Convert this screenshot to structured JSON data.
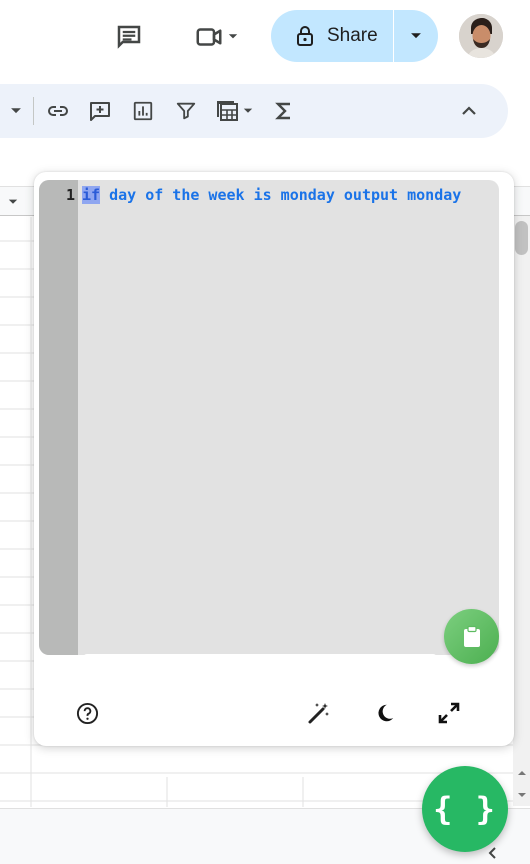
{
  "header": {
    "share_label": "Share",
    "comments_icon": "comment-icon",
    "meet_icon": "video-camera-icon",
    "avatar": "user-avatar"
  },
  "toolbar": {
    "items": [
      "link-icon",
      "insert-comment-icon",
      "insert-chart-icon",
      "filter-icon",
      "table-view-icon",
      "functions-icon"
    ],
    "collapse_icon": "chevron-up-icon"
  },
  "editor": {
    "line_number": "1",
    "code_keyword": "if",
    "code_rest": " day of the week is monday output monday",
    "copy_icon": "clipboard-icon"
  },
  "panel_footer": {
    "help_icon": "help-circle-icon",
    "magic_icon": "auto-fix-icon",
    "dark_mode_icon": "moon-icon",
    "expand_icon": "expand-icon"
  },
  "fab": {
    "label": "{ }"
  },
  "colors": {
    "share_bg": "#c2e7ff",
    "toolbar_bg": "#edf2fa",
    "code_text": "#1a73e8",
    "fab_green": "#27b864"
  }
}
